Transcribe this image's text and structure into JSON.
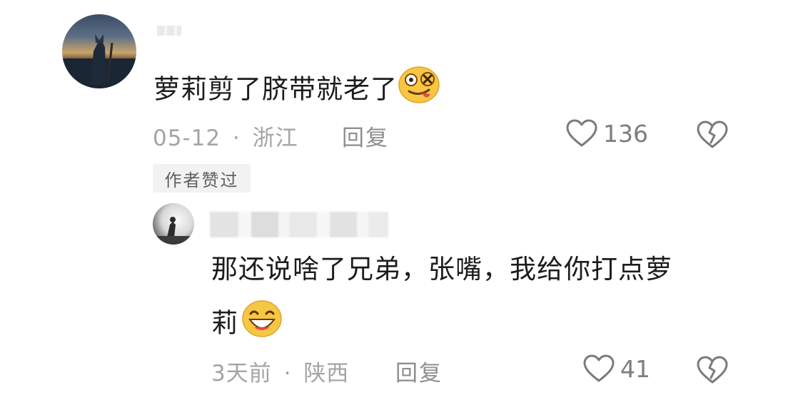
{
  "comment": {
    "text": "萝莉剪了脐带就老了",
    "date": "05-12",
    "separator": "·",
    "location": "浙江",
    "reply_label": "回复",
    "likes": "136",
    "author_badge": "作者赞过"
  },
  "reply": {
    "text_line1": "那还说啥了兄弟，张嘴，我给你打点萝",
    "text_line2": "莉",
    "date": "3天前",
    "separator": "·",
    "location": "陕西",
    "reply_label": "回复",
    "likes": "41"
  }
}
